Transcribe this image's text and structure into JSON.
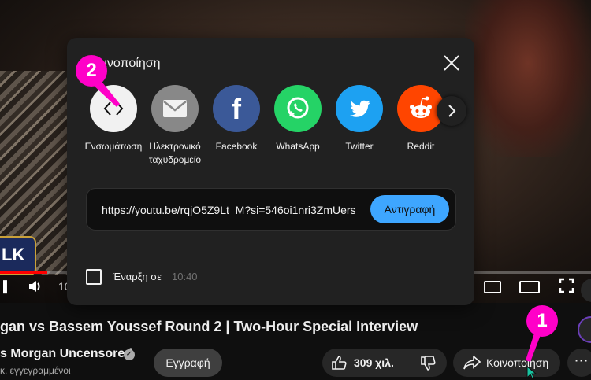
{
  "video": {
    "logo_text": "LK",
    "time_display": "10",
    "title": "gan vs Bassem Youssef Round 2 | Two-Hour Special Interview",
    "channel_name": "s Morgan Uncensored",
    "subscribers": "κ. εγγεγραμμένοι",
    "subscribe_label": "Εγγραφή",
    "like_count": "309 χιλ.",
    "share_label": "Κοινοποίηση",
    "more_label": "⋯"
  },
  "dialog": {
    "title": "Κοινοποίηση",
    "share_targets": [
      {
        "label": "Ενσωμάτωση",
        "icon": "embed-icon",
        "color": "#f1f1f1"
      },
      {
        "label": "Ηλεκτρονικό ταχυδρομείο",
        "icon": "email-icon",
        "color": "#888888"
      },
      {
        "label": "Facebook",
        "icon": "facebook-icon",
        "color": "#3b5998"
      },
      {
        "label": "WhatsApp",
        "icon": "whatsapp-icon",
        "color": "#25d366"
      },
      {
        "label": "Twitter",
        "icon": "twitter-icon",
        "color": "#1da1f2"
      },
      {
        "label": "Reddit",
        "icon": "reddit-icon",
        "color": "#ff4500"
      }
    ],
    "url": "https://youtu.be/rqjO5Z9Lt_M?si=546oi1nri3ZmUers",
    "copy_label": "Αντιγραφή",
    "start_label": "Έναρξη σε",
    "start_time": "10:40"
  },
  "annotations": {
    "marker_1": "1",
    "marker_2": "2",
    "accent_color": "#ff00c8"
  }
}
